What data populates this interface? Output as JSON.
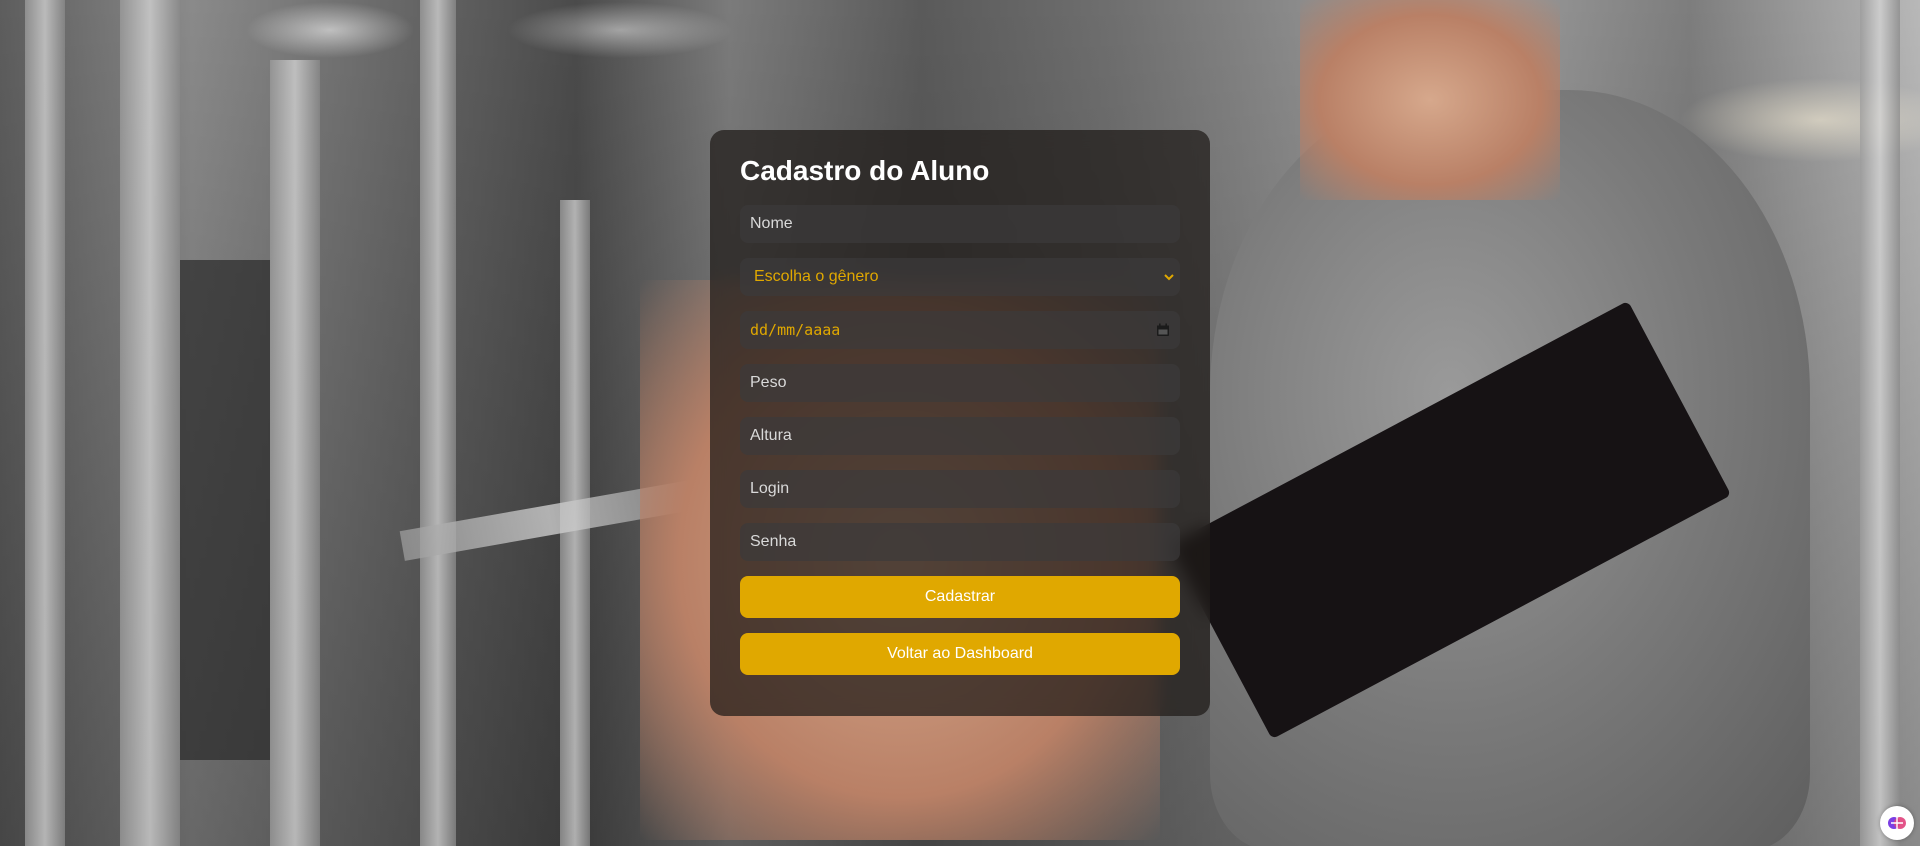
{
  "form": {
    "title": "Cadastro do Aluno",
    "fields": {
      "nome_placeholder": "Nome",
      "genero_selected": "Escolha o gênero",
      "data_placeholder": "dd/mm/aaaa",
      "peso_placeholder": "Peso",
      "altura_placeholder": "Altura",
      "login_placeholder": "Login",
      "senha_placeholder": "Senha"
    },
    "buttons": {
      "submit_label": "Cadastrar",
      "back_label": "Voltar ao Dashboard"
    }
  },
  "theme": {
    "accent": "#e0a800",
    "card_bg": "rgba(30,26,24,0.72)",
    "field_bg": "rgba(60,58,58,0.7)",
    "title_color": "#ffffff"
  },
  "icons": {
    "select": "chevron-down-icon",
    "date": "calendar-icon",
    "corner": "extension-icon"
  }
}
